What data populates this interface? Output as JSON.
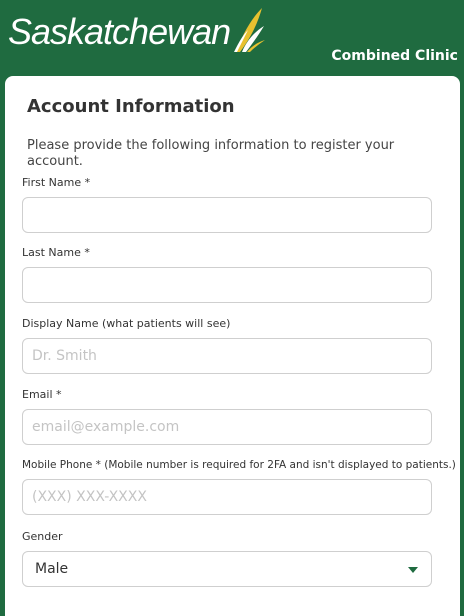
{
  "header": {
    "logo_text": "Saskatchewan",
    "clinic_name": "Combined Clinic"
  },
  "form": {
    "title": "Account Information",
    "intro": "Please provide the following information to register your account.",
    "fields": {
      "first_name": {
        "label": "First Name *",
        "value": "",
        "placeholder": ""
      },
      "last_name": {
        "label": "Last Name *",
        "value": "",
        "placeholder": ""
      },
      "display_name": {
        "label": "Display Name (what patients will see)",
        "value": "",
        "placeholder": "Dr. Smith"
      },
      "email": {
        "label": "Email *",
        "value": "",
        "placeholder": "email@example.com"
      },
      "mobile_phone": {
        "label": "Mobile Phone * (Mobile number is required for 2FA and isn't displayed to patients.)",
        "value": "",
        "placeholder": "(XXX) XXX-XXXX"
      },
      "gender": {
        "label": "Gender",
        "selected": "Male"
      }
    }
  },
  "colors": {
    "brand_green": "#1f6b40",
    "logo_yellow": "#e8c12f"
  },
  "icons": {
    "logo_mark": "wheat-sheaf-icon",
    "dropdown": "caret-down-icon"
  }
}
